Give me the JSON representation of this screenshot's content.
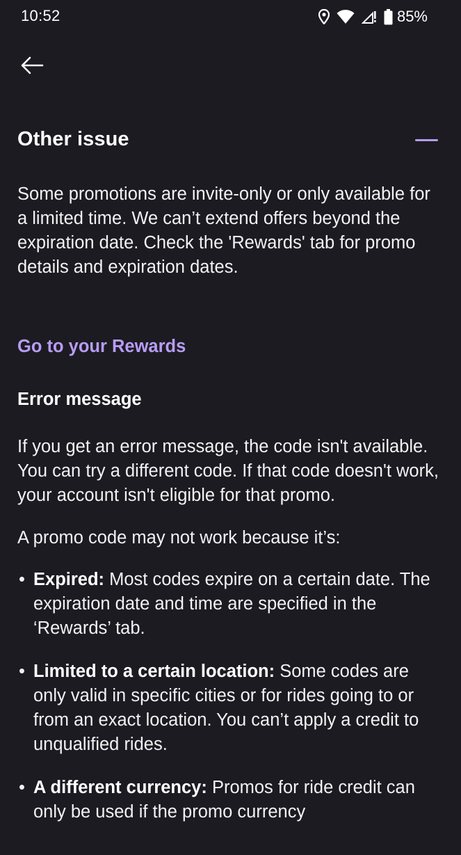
{
  "status_bar": {
    "time": "10:52",
    "battery": "85%",
    "icons": [
      "location-icon",
      "wifi-icon",
      "signal-icon",
      "battery-icon"
    ]
  },
  "nav": {
    "back_icon": "arrow-left-icon"
  },
  "section": {
    "title": "Other issue",
    "collapse_icon": "minus-icon",
    "intro": "Some promotions are invite-only or only available for a limited time. We can’t extend offers beyond the expiration date. Check the 'Rewards' tab for promo details and expiration dates.",
    "rewards_link": "Go to your Rewards",
    "error_heading": "Error message",
    "error_text": "If you get an error message, the code isn't available. You can try a different code. If that code doesn't work, your account isn't eligible for that promo.",
    "reasons_intro": "A promo code may not work because it’s:",
    "reasons": [
      {
        "term": "Expired:",
        "text": " Most codes expire on a certain date. The expiration date and time are specified in the ‘Rewards’ tab."
      },
      {
        "term": "Limited to a certain location:",
        "text": " Some codes are only valid in specific cities or for rides going to or from an exact location. You can’t apply a credit to unqualified rides."
      },
      {
        "term": "A different currency:",
        "text": " Promos for ride credit can only be used if the promo currency"
      }
    ]
  },
  "colors": {
    "background": "#1c1b22",
    "accent": "#b79cf2",
    "text": "#ffffff"
  }
}
